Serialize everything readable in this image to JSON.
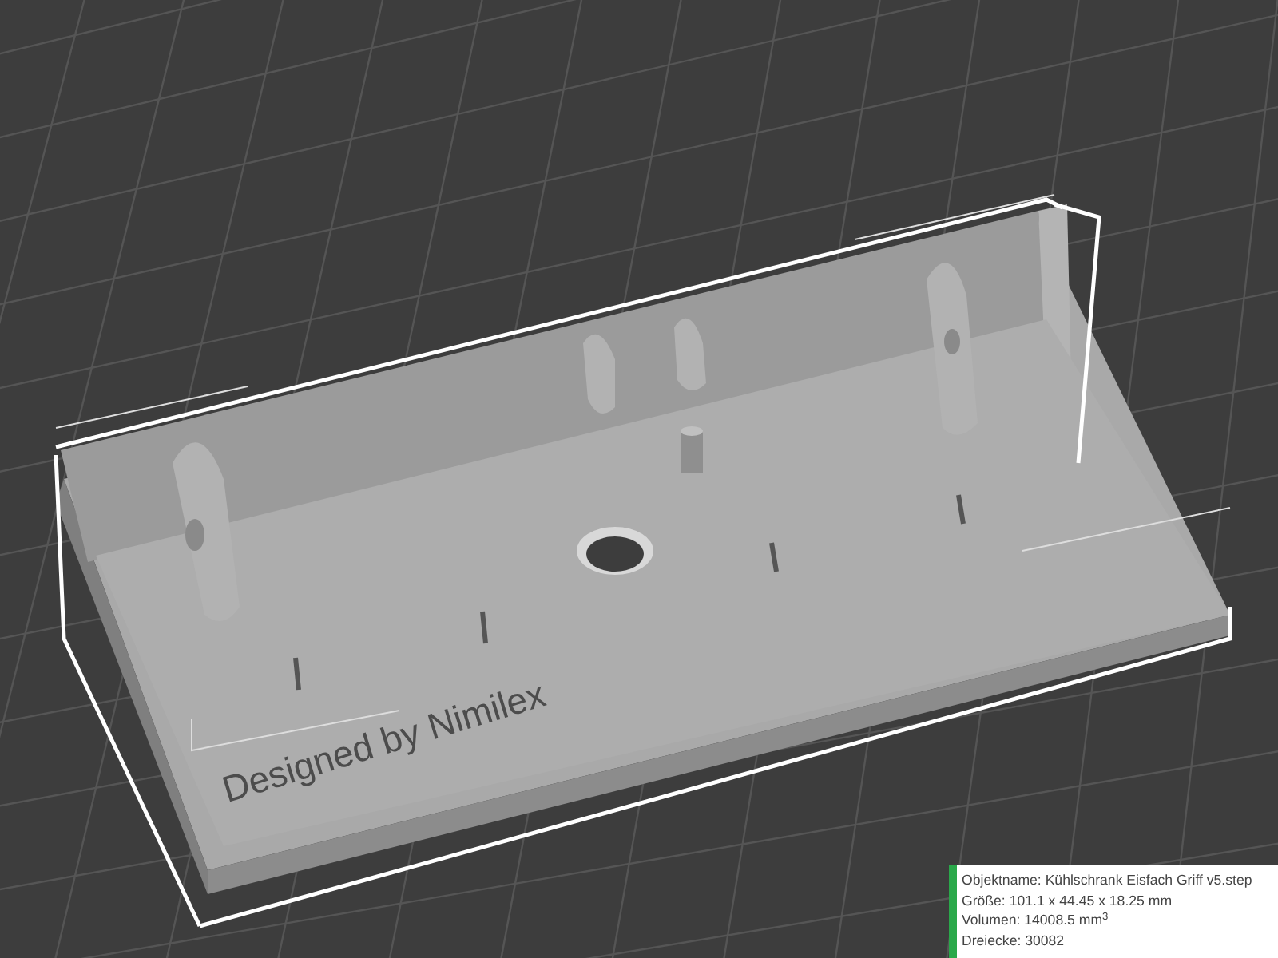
{
  "model_label": {
    "text": "Designed by Nimilex"
  },
  "info_panel": {
    "lines": [
      "Objektname: Kühlschrank Eisfach Griff v5.step",
      "Größe: 101.1 x 44.45 x 18.25 mm",
      "Volumen: 14008.5 mm$^{3}$",
      "Dreiecke: 30082"
    ]
  }
}
